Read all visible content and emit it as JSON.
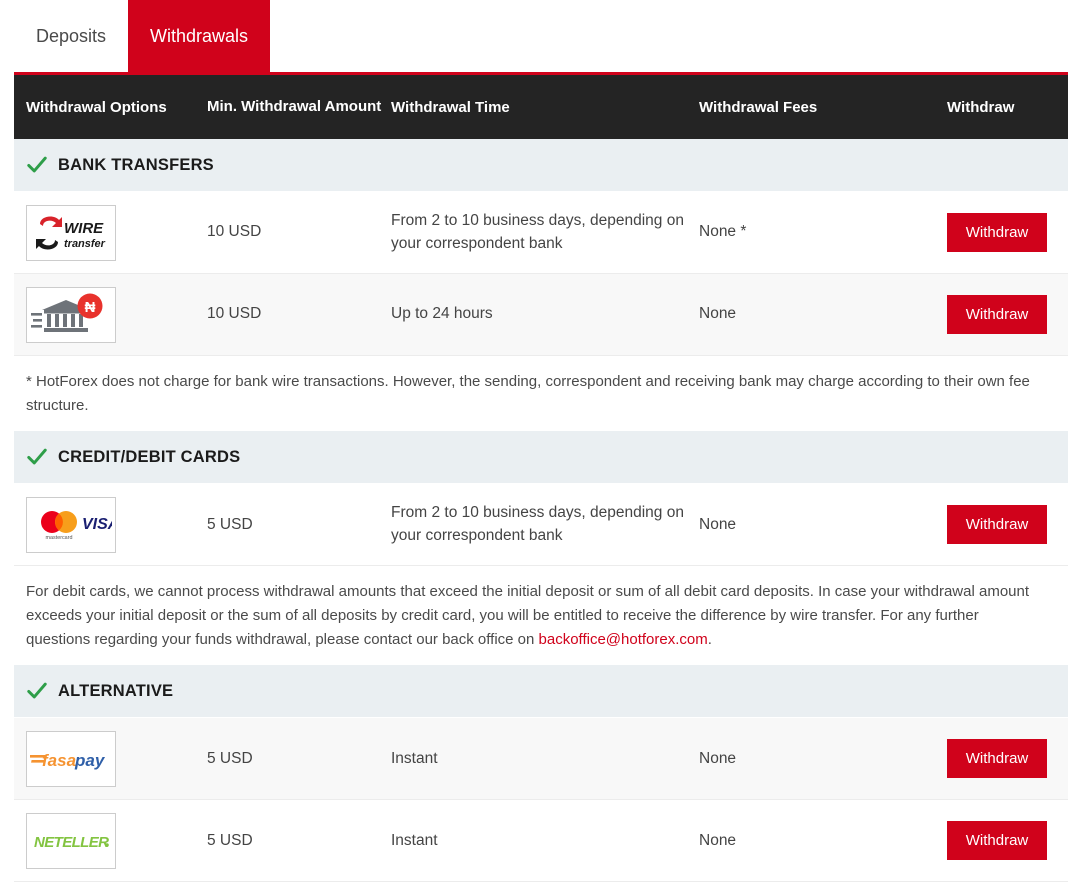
{
  "tabs": [
    {
      "label": "Deposits",
      "active": false
    },
    {
      "label": "Withdrawals",
      "active": true
    }
  ],
  "table": {
    "columns": [
      "Withdrawal Options",
      "Min. Withdrawal Amount",
      "Withdrawal Time",
      "Withdrawal Fees",
      "Withdraw"
    ]
  },
  "sections": [
    {
      "title": "BANK TRANSFERS",
      "icon": "green-check-icon",
      "rows": [
        {
          "logo": "wire-transfer-logo",
          "min_amount": "10 USD",
          "time": "From 2 to 10 business days, depending on your correspondent bank",
          "fees": "None *",
          "action": "Withdraw"
        },
        {
          "logo": "bank-naira-logo",
          "min_amount": "10 USD",
          "time": "Up to 24 hours",
          "fees": "None",
          "action": "Withdraw"
        }
      ],
      "note": "* HotForex does not charge for bank wire transactions. However, the sending, correspondent and receiving bank may charge according to their own fee structure."
    },
    {
      "title": "CREDIT/DEBIT CARDS",
      "icon": "green-check-icon",
      "rows": [
        {
          "logo": "mastercard-visa-logo",
          "min_amount": "5 USD",
          "time": "From 2 to 10 business days, depending on your correspondent bank",
          "fees": "None",
          "action": "Withdraw"
        }
      ],
      "note_parts": {
        "before": "For debit cards, we cannot process withdrawal amounts that exceed the initial deposit or sum of all debit card deposits. In case your withdrawal amount exceeds your initial deposit or the sum of all deposits by credit card, you will be entitled to receive the difference by wire transfer. For any further questions regarding your funds withdrawal, please contact our back office on ",
        "link": "backoffice@hotforex.com",
        "after": "."
      }
    },
    {
      "title": "ALTERNATIVE",
      "icon": "green-check-icon",
      "rows": [
        {
          "logo": "fasapay-logo",
          "min_amount": "5 USD",
          "time": "Instant",
          "fees": "None",
          "action": "Withdraw"
        },
        {
          "logo": "neteller-logo",
          "min_amount": "5 USD",
          "time": "Instant",
          "fees": "None",
          "action": "Withdraw"
        }
      ]
    }
  ],
  "logos": {
    "wire": {
      "word": "WIRE",
      "sub": "transfer"
    },
    "mastercard": {
      "word": "mastercard"
    },
    "visa": {
      "word": "VISA"
    },
    "fasapay": {
      "part1": "fasa",
      "part2": "pay"
    },
    "neteller": {
      "word": "NETELLER"
    },
    "naira": {
      "symbol": "₦"
    }
  },
  "colors": {
    "accent_red": "#D0021B",
    "header_dark": "#242424",
    "band_grey": "#EAEFF2",
    "check_green": "#2E9E49",
    "link_red": "#D0021B"
  }
}
